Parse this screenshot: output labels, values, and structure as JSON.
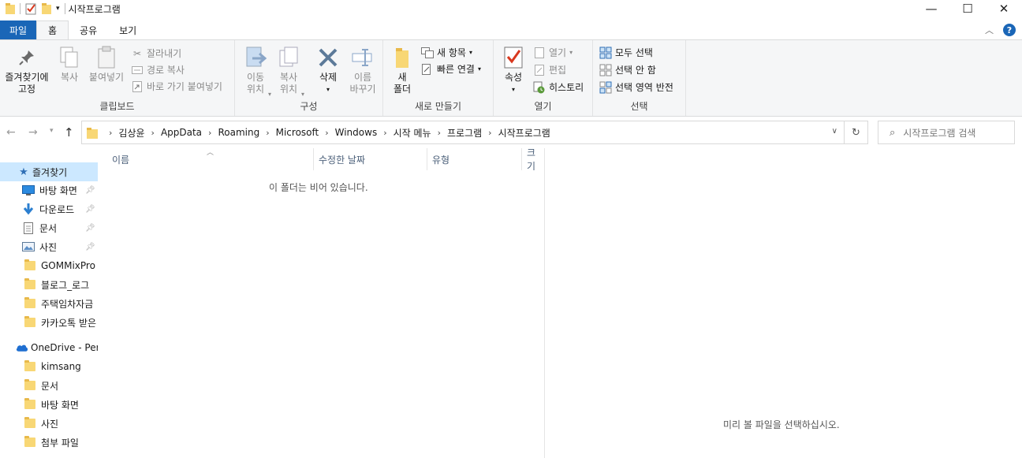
{
  "window": {
    "title": "시작프로그램",
    "controls": {
      "minimize": "—",
      "maximize": "☐",
      "close": "✕"
    }
  },
  "tabs": [
    "파일",
    "홈",
    "공유",
    "보기"
  ],
  "ribbon": {
    "clipboard": {
      "pin": "즐겨찾기에\n고정",
      "copy": "복사",
      "paste": "붙여넣기",
      "cut": "잘라내기",
      "copy_path": "경로 복사",
      "paste_shortcut": "바로 가기 붙여넣기",
      "label": "클립보드"
    },
    "organize": {
      "move_to": "이동\n위치",
      "copy_to": "복사\n위치",
      "delete": "삭제",
      "rename": "이름\n바꾸기",
      "label": "구성"
    },
    "new": {
      "new_folder": "새\n폴더",
      "new_item": "새 항목",
      "easy_access": "빠른 연결",
      "label": "새로 만들기"
    },
    "open": {
      "properties": "속성",
      "open": "열기",
      "edit": "편집",
      "history": "히스토리",
      "label": "열기"
    },
    "select": {
      "select_all": "모두 선택",
      "select_none": "선택 안 함",
      "invert": "선택 영역 반전",
      "label": "선택"
    }
  },
  "address": {
    "crumbs": [
      "김상윤",
      "AppData",
      "Roaming",
      "Microsoft",
      "Windows",
      "시작 메뉴",
      "프로그램",
      "시작프로그램"
    ],
    "search_placeholder": "시작프로그램 검색"
  },
  "nav": {
    "quick_access": "즐겨찾기",
    "items": [
      {
        "label": "바탕 화면",
        "pinned": true,
        "icon": "desktop-icon"
      },
      {
        "label": "다운로드",
        "pinned": true,
        "icon": "download-icon"
      },
      {
        "label": "문서",
        "pinned": true,
        "icon": "document-icon"
      },
      {
        "label": "사진",
        "pinned": true,
        "icon": "picture-icon"
      },
      {
        "label": "GOMMixPro",
        "pinned": false,
        "icon": "folder-icon"
      },
      {
        "label": "블로그_로그",
        "pinned": false,
        "icon": "folder-icon"
      },
      {
        "label": "주택임차자금",
        "pinned": false,
        "icon": "folder-icon"
      },
      {
        "label": "카카오톡 받은",
        "pinned": false,
        "icon": "folder-icon"
      }
    ],
    "onedrive": "OneDrive - Per",
    "onedrive_items": [
      "kimsang",
      "문서",
      "바탕 화면",
      "사진",
      "첨부 파일"
    ]
  },
  "columns": [
    "이름",
    "수정한 날짜",
    "유형",
    "크기"
  ],
  "empty_message": "이 폴더는 비어 있습니다.",
  "preview_message": "미리 볼 파일을 선택하십시오."
}
